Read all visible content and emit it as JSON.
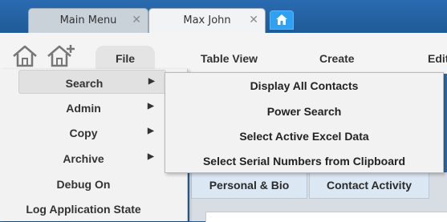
{
  "tabs": [
    {
      "label": "Main Menu",
      "close": "✕"
    },
    {
      "label": "Max John",
      "close": "✕"
    }
  ],
  "toolbar": {
    "file": "File",
    "table_view": "Table View",
    "create": "Create",
    "edit": "Edit"
  },
  "file_menu": {
    "items": [
      {
        "label": "Search",
        "arrow": "▶"
      },
      {
        "label": "Admin",
        "arrow": "▶"
      },
      {
        "label": "Copy",
        "arrow": "▶"
      },
      {
        "label": "Archive",
        "arrow": "▶"
      },
      {
        "label": "Debug On"
      },
      {
        "label": "Log Application State"
      }
    ]
  },
  "search_submenu": {
    "items": [
      {
        "label": "Display All Contacts"
      },
      {
        "label": "Power Search"
      },
      {
        "label": "Select Active Excel Data"
      },
      {
        "label": "Select Serial Numbers from Clipboard"
      }
    ]
  },
  "subtabs": [
    {
      "label": "Personal & Bio"
    },
    {
      "label": "Contact Activity"
    }
  ],
  "colors": {
    "title_bar": "#1f5a98",
    "home_tab": "#2ea1f3",
    "menu_bg": "#f2f2f2",
    "subtab_bg": "#dbe7f3"
  },
  "icons": [
    "home-icon",
    "add-home-icon",
    "close-icon",
    "submenu-arrow-icon"
  ]
}
